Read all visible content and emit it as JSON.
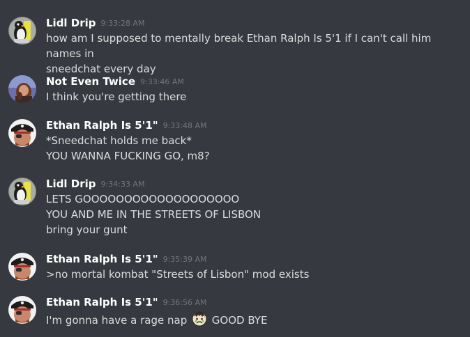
{
  "messages": [
    {
      "author": "Lidl Drip",
      "avatar_icon": "penguin-avatar-icon",
      "timestamp": "9:33:28 AM",
      "lines": [
        "how am I supposed to mentally break Ethan Ralph Is 5'1 if I can't call him names in",
        "sneedchat every day"
      ]
    },
    {
      "author": "Not Even Twice",
      "avatar_icon": "person-photo-avatar-icon",
      "timestamp": "9:33:46 AM",
      "lines": [
        "I think you're getting there"
      ]
    },
    {
      "author": "Ethan Ralph Is 5'1\"",
      "avatar_icon": "pirate-avatar-icon",
      "timestamp": "9:33:48 AM",
      "lines": [
        "*Sneedchat holds me back*",
        "YOU WANNA FUCKING GO, m8?"
      ]
    },
    {
      "author": "Lidl Drip",
      "avatar_icon": "penguin-avatar-icon",
      "timestamp": "9:34:33 AM",
      "lines": [
        "LETS GOOOOOOOOOOOOOOOOOOO",
        "YOU AND ME IN THE STREETS OF LISBON",
        "bring your gunt"
      ]
    },
    {
      "author": "Ethan Ralph Is 5'1\"",
      "avatar_icon": "pirate-avatar-icon",
      "timestamp": "9:35:39 AM",
      "lines": [
        ">no mortal kombat \"Streets of Lisbon\" mod exists"
      ]
    },
    {
      "author": "Ethan Ralph Is 5'1\"",
      "avatar_icon": "pirate-avatar-icon",
      "timestamp": "9:36:56 AM",
      "text_before_emoji": "I'm gonna have a rage nap ",
      "emoji_icon": "sad-face-emoji-icon",
      "text_after_emoji": " GOOD BYE"
    }
  ]
}
